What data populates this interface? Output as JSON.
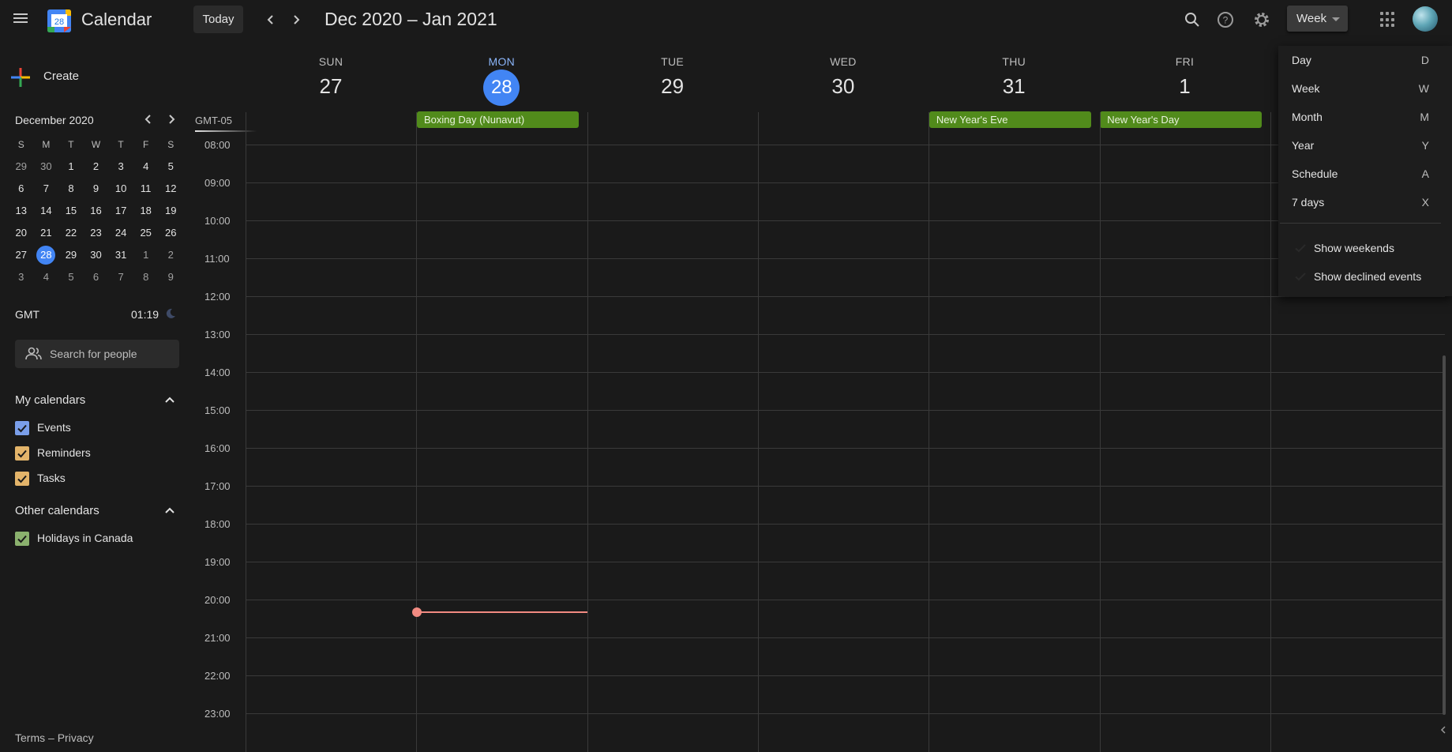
{
  "header": {
    "app_title": "Calendar",
    "logo_day": "28",
    "today_label": "Today",
    "date_range": "Dec 2020 – Jan 2021",
    "view_label": "Week",
    "prev_icon": "chevron-left-icon",
    "next_icon": "chevron-right-icon"
  },
  "sidebar": {
    "create_label": "Create",
    "mini_calendar": {
      "title": "December 2020",
      "days_of_week": [
        "S",
        "M",
        "T",
        "W",
        "T",
        "F",
        "S"
      ],
      "weeks": [
        [
          "29",
          "30",
          "1",
          "2",
          "3",
          "4",
          "5"
        ],
        [
          "6",
          "7",
          "8",
          "9",
          "10",
          "11",
          "12"
        ],
        [
          "13",
          "14",
          "15",
          "16",
          "17",
          "18",
          "19"
        ],
        [
          "20",
          "21",
          "22",
          "23",
          "24",
          "25",
          "26"
        ],
        [
          "27",
          "28",
          "29",
          "30",
          "31",
          "1",
          "2"
        ],
        [
          "3",
          "4",
          "5",
          "6",
          "7",
          "8",
          "9"
        ]
      ],
      "selected": "28"
    },
    "timezone": {
      "label": "GMT",
      "time": "01:19"
    },
    "search_people_placeholder": "Search for people",
    "my_calendars": {
      "title": "My calendars",
      "items": [
        {
          "label": "Events",
          "color": "#7a9ee9"
        },
        {
          "label": "Reminders",
          "color": "#e3b46a"
        },
        {
          "label": "Tasks",
          "color": "#e3b46a"
        }
      ]
    },
    "other_calendars": {
      "title": "Other calendars",
      "items": [
        {
          "label": "Holidays in Canada",
          "color": "#8bb16e"
        }
      ]
    },
    "footer": {
      "terms": "Terms",
      "separator": "–",
      "privacy": "Privacy"
    }
  },
  "week": {
    "timezone_label": "GMT-05",
    "days": [
      {
        "dow": "SUN",
        "num": "27"
      },
      {
        "dow": "MON",
        "num": "28",
        "today": true
      },
      {
        "dow": "TUE",
        "num": "29"
      },
      {
        "dow": "WED",
        "num": "30"
      },
      {
        "dow": "THU",
        "num": "31"
      },
      {
        "dow": "FRI",
        "num": "1"
      }
    ],
    "all_day_events": [
      {
        "title": "Boxing Day (Nunavut)",
        "day_index": 1
      },
      {
        "title": "New Year's Eve",
        "day_index": 4
      },
      {
        "title": "New Year's Day",
        "day_index": 5
      }
    ],
    "hours": [
      "08:00",
      "09:00",
      "10:00",
      "11:00",
      "12:00",
      "13:00",
      "14:00",
      "15:00",
      "16:00",
      "17:00",
      "18:00",
      "19:00",
      "20:00",
      "21:00",
      "22:00",
      "23:00"
    ],
    "event_color": "#518b1b",
    "now_indicator_color": "#f28b82"
  },
  "view_menu": {
    "items": [
      {
        "label": "Day",
        "key": "D"
      },
      {
        "label": "Week",
        "key": "W"
      },
      {
        "label": "Month",
        "key": "M"
      },
      {
        "label": "Year",
        "key": "Y"
      },
      {
        "label": "Schedule",
        "key": "A"
      },
      {
        "label": "7 days",
        "key": "X"
      }
    ],
    "toggles": [
      {
        "label": "Show weekends"
      },
      {
        "label": "Show declined events"
      }
    ]
  }
}
